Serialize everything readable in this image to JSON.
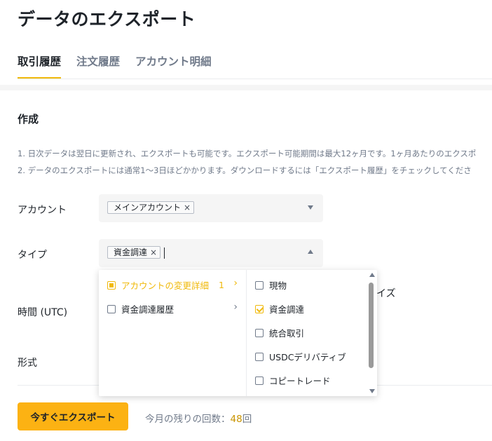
{
  "page": {
    "title": "データのエクスポート"
  },
  "tabs": [
    {
      "label": "取引履歴",
      "active": true
    },
    {
      "label": "注文履歴",
      "active": false
    },
    {
      "label": "アカウント明細",
      "active": false
    }
  ],
  "form": {
    "section_title": "作成",
    "notes": [
      "1.  日次データは翌日に更新され、エクスポートも可能です。エクスポート可能期間は最大12ヶ月です。1ヶ月あたりのエクスポ",
      "2.  データのエクスポートには通常1〜3日ほどかかります。ダウンロードするには「エクスポート履歴」をチェックしてくださ"
    ],
    "account": {
      "label": "アカウント",
      "tag": "メインアカウント"
    },
    "type": {
      "label": "タイプ",
      "tag": "資金調達"
    },
    "time": {
      "label": "時間 (UTC)"
    },
    "format": {
      "label": "形式"
    },
    "obscured_text": "イズ"
  },
  "dropdown": {
    "left": [
      {
        "label": "アカウントの変更詳細",
        "count": "1",
        "state": "partial",
        "active": true
      },
      {
        "label": "資金調達履歴",
        "count": "",
        "state": "unchecked",
        "active": false
      }
    ],
    "right": [
      {
        "label": "現物",
        "checked": false
      },
      {
        "label": "資金調達",
        "checked": true
      },
      {
        "label": "統合取引",
        "checked": false
      },
      {
        "label": "USDCデリバティブ",
        "checked": false
      },
      {
        "label": "コピートレード",
        "checked": false
      }
    ]
  },
  "footer": {
    "export_button": "今すぐエクスポート",
    "remaining_prefix": "今月の残りの回数：",
    "remaining_count": "48",
    "remaining_suffix": "回"
  },
  "colors": {
    "accent": "#f0b90b",
    "button": "#fcb213",
    "text_muted": "#707a8a"
  },
  "icons": [
    "close-icon",
    "chevron-down-icon",
    "chevron-up-icon",
    "chevron-right-icon",
    "checkbox-icon"
  ]
}
